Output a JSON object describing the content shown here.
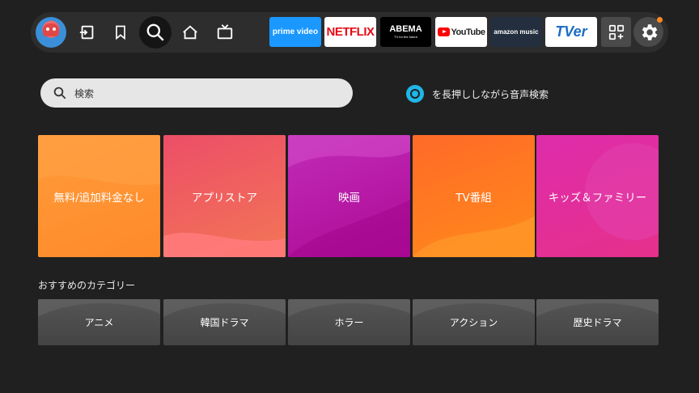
{
  "nav": {
    "items": [
      {
        "name": "input-icon"
      },
      {
        "name": "bookmark-icon"
      },
      {
        "name": "search-icon",
        "active": true
      },
      {
        "name": "home-icon"
      },
      {
        "name": "live-tv-icon"
      }
    ]
  },
  "apps": {
    "prime_video": "prime video",
    "netflix": "NETFLIX",
    "abema": "ABEMA",
    "abema_tagline": "TV for the future",
    "youtube": "YouTube",
    "amazon_music": "amazon music",
    "tver": "TVer"
  },
  "colors": {
    "accent_notification": "#ff8a1f",
    "alexa": "#1fb6e8",
    "background": "#202020"
  },
  "search": {
    "placeholder": "検索"
  },
  "voice": {
    "hint": "を長押ししながら音声検索"
  },
  "featured": [
    {
      "label": "無料/追加料金なし"
    },
    {
      "label": "アプリストア"
    },
    {
      "label": "映画"
    },
    {
      "label": "TV番組"
    },
    {
      "label": "キッズ＆ファミリー"
    }
  ],
  "categories": {
    "title": "おすすめのカテゴリー",
    "items": [
      {
        "label": "アニメ"
      },
      {
        "label": "韓国ドラマ"
      },
      {
        "label": "ホラー"
      },
      {
        "label": "アクション"
      },
      {
        "label": "歴史ドラマ"
      }
    ]
  }
}
